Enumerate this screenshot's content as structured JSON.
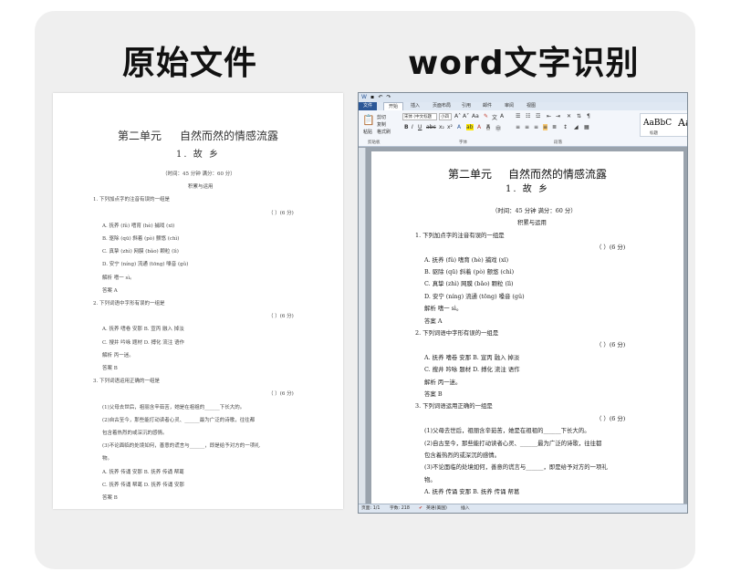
{
  "headings": {
    "left": "原始文件",
    "right": "word文字识别"
  },
  "scan": {
    "unit": "第二单元",
    "title": "自然而然的情感流露",
    "lesson": "1. 故  乡",
    "lines": [
      "（时间：45 分钟  满分：60 分）",
      "积累与运用",
      "1. 下列加点字的注音有误的一组是",
      "（    ）(6 分)",
      "A. 抚养 (fǔ)          嗜育 (hè)          捕戏 (xī)",
      "B. 驱除 (qū)          斜着 (pò)          颤悠 (chì)",
      "C. 真挚 (zhì)         网膜 (bǎo)         颗粒 (lì)",
      "D. 安宁 (níng)        流通 (tōng)        嗓音 (gǔ)",
      "解析  嗜一 sì。",
      "答案  A",
      "2. 下列词语中字形有误的一组是",
      "（    ）(6 分)",
      "A. 抚养   嗜卷   安那              B. 宣丙   融入   掉淡",
      "C. 搜井   吟咏   题材              D. 搏化   流注   语作",
      "解析  丙一迷。",
      "答案  B",
      "3. 下列词语运用正确的一组是",
      "（    ）(6 分)",
      "(1)父母去世后，祖丽含辛茹苦，她是在祖祖的______下长大的。",
      "(2)自古至今，那些能打动读者心灵、______最为广泛的诗歌，往往都",
      "包含着热烈的或深沉的感情。",
      "(3)不论面临的处境如何，善意的谎言与______，即是给予对方的一项礼",
      "物。",
      "A. 抚养   传诵   安那              B. 抚养   传诵   帮葛",
      "C. 抚养   传诵   帮葛              D. 抚养   传诵   安那",
      "答案  B"
    ]
  },
  "word": {
    "tabs": [
      "文件",
      "开始",
      "插入",
      "页面布局",
      "引用",
      "邮件",
      "审阅",
      "视图"
    ],
    "ribbon": {
      "paste": "粘贴",
      "cut": "剪切",
      "copy": "复制",
      "format_painter": "格式刷",
      "font_name": "宋体 (中文标题",
      "font_size": "小四",
      "clipboard_label": "剪贴板",
      "font_label": "字体",
      "paragraph_label": "段落",
      "style_sample": "AaBbC",
      "style_sample2": "Aa",
      "style_name": "标题"
    },
    "doc": {
      "unit": "第二单元",
      "title": "自然而然的情感流露",
      "lesson": "1. 故  乡",
      "lines": [
        "（时间：45 分钟  满分：60 分）",
        "积累与运用",
        "1. 下列加点字的注音有误的一组是",
        "（    ）(6 分)",
        "A. 抚养 (fǔ)          嗜育 (hè)          捕戏 (xī)",
        "B. 驱除 (qū)          斜着 (pò)          颤悠 (chì)",
        "C. 真挚 (zhì)         网膜 (bǎo)         颗粒 (lì)",
        "D. 安宁 (níng)        流通 (tōng)        嗓音 (gǔ)",
        "解析  嗜一 sì。",
        "答案  A",
        "2. 下列词语中字形有误的一组是",
        "（    ）(6 分)",
        "A. 抚养   嗜卷   安那              B. 宣丙   融入   掉淡",
        "C. 搜井   吟咏   题材              D. 搏化   流注   语作",
        "解析  丙一迷。",
        "答案  B",
        "3. 下列词语运用正确的一组是",
        "（    ）(6 分)",
        "(1)父母去世后，祖丽含辛茹苦，她是在祖祖的______下长大的。",
        "(2)自古至今，那些能打动读者心灵、______最为广泛的诗歌，往往都",
        "包含着热烈的或深沉的感情。",
        "(3)不论面临的处境如何，善意的谎言与______，即是给予对方的一项礼",
        "物。",
        "A. 抚养   传诵   安那              B. 抚养   传诵   帮葛"
      ]
    },
    "status": {
      "page": "页面: 1/1",
      "words": "字数: 218",
      "lang": "英语(美国)",
      "insert": "插入"
    }
  }
}
